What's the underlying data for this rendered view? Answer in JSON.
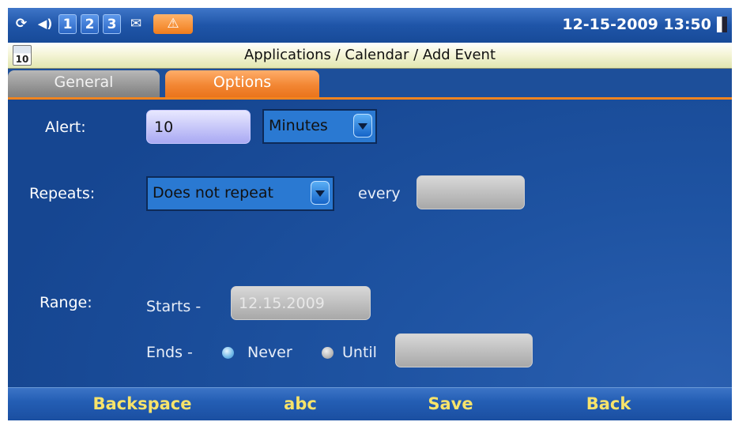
{
  "status_bar": {
    "icons": [
      "sync-icon",
      "volume-icon",
      "line-icon",
      "line-icon",
      "line-icon",
      "message-icon",
      "alert-icon"
    ],
    "line_labels": [
      "1",
      "2",
      "3"
    ],
    "datetime": "12-15-2009 13:50"
  },
  "header": {
    "calendar_icon_day": "10",
    "breadcrumb": "Applications / Calendar / Add Event"
  },
  "tabs": [
    {
      "label": "General",
      "active": false
    },
    {
      "label": "Options",
      "active": true
    }
  ],
  "form": {
    "alert": {
      "label": "Alert:",
      "value": "10",
      "unit": "Minutes"
    },
    "repeats": {
      "label": "Repeats:",
      "value": "Does not repeat",
      "every_label": "every",
      "every_value": ""
    },
    "range": {
      "label": "Range:",
      "starts_label": "Starts -",
      "starts_value": "12.15.2009",
      "ends_label": "Ends -",
      "ends_options": [
        {
          "label": "Never",
          "selected": true
        },
        {
          "label": "Until",
          "selected": false
        }
      ],
      "until_value": ""
    }
  },
  "softkeys": [
    "Backspace",
    "abc",
    "Save",
    "Back"
  ],
  "colors": {
    "accent": "#f0841f",
    "background": "#1d4f9a",
    "softkey_text": "#f7e36a"
  }
}
